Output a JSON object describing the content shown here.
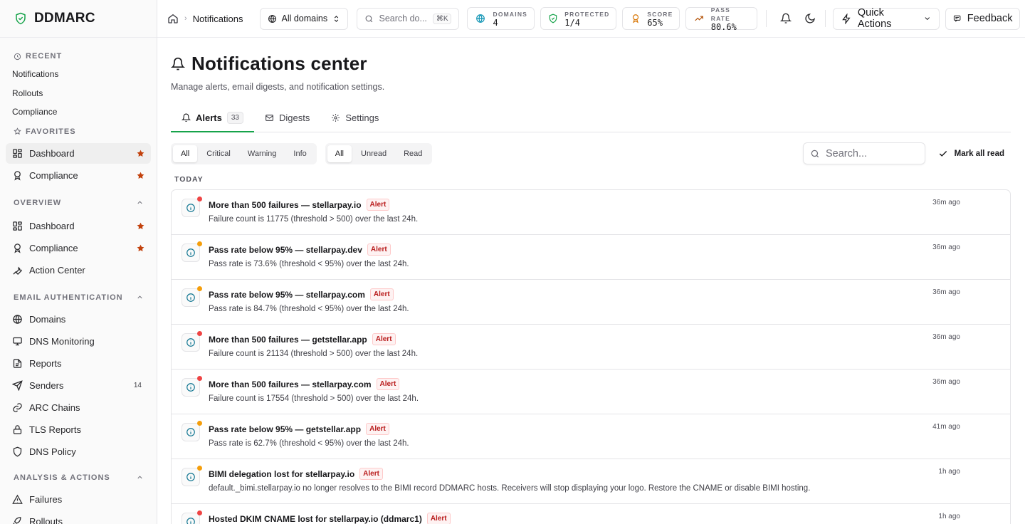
{
  "brand": {
    "name": "DDMARC"
  },
  "sidebar": {
    "recent_header": "RECENT",
    "recent": [
      "Notifications",
      "Rollouts",
      "Compliance"
    ],
    "favorites_header": "FAVORITES",
    "favorites": [
      {
        "label": "Dashboard"
      },
      {
        "label": "Compliance"
      }
    ],
    "overview_header": "OVERVIEW",
    "overview": [
      {
        "label": "Dashboard"
      },
      {
        "label": "Compliance"
      },
      {
        "label": "Action Center"
      }
    ],
    "email_auth_header": "EMAIL AUTHENTICATION",
    "email_auth": [
      {
        "label": "Domains"
      },
      {
        "label": "DNS Monitoring"
      },
      {
        "label": "Reports"
      },
      {
        "label": "Senders",
        "count": "14"
      },
      {
        "label": "ARC Chains"
      },
      {
        "label": "TLS Reports"
      },
      {
        "label": "DNS Policy"
      }
    ],
    "analysis_header": "ANALYSIS & ACTIONS",
    "analysis": [
      {
        "label": "Failures"
      },
      {
        "label": "Rollouts"
      }
    ]
  },
  "topbar": {
    "breadcrumb": "Notifications",
    "domain_select": "All domains",
    "search_placeholder": "Search do...",
    "search_kbd": "⌘K",
    "stats": [
      {
        "label": "DOMAINS",
        "value": "4",
        "icon": "globe-icon",
        "color": "#0891b2"
      },
      {
        "label": "PROTECTED",
        "value": "1/4",
        "icon": "shield-check-icon",
        "color": "#16a34a"
      },
      {
        "label": "SCORE",
        "value": "65%",
        "icon": "award-icon",
        "color": "#d97706"
      },
      {
        "label": "PASS RATE",
        "value": "80.6%",
        "icon": "trend-icon",
        "color": "#b45309"
      }
    ],
    "quick_actions": "Quick Actions",
    "feedback": "Feedback"
  },
  "page": {
    "title": "Notifications center",
    "subtitle": "Manage alerts, email digests, and notification settings.",
    "tabs": [
      {
        "label": "Alerts",
        "badge": "33"
      },
      {
        "label": "Digests"
      },
      {
        "label": "Settings"
      }
    ],
    "severity_filters": [
      "All",
      "Critical",
      "Warning",
      "Info"
    ],
    "read_filters": [
      "All",
      "Unread",
      "Read"
    ],
    "search_placeholder": "Search...",
    "mark_all_read": "Mark all read",
    "day_label": "TODAY"
  },
  "alerts": [
    {
      "title": "More than 500 failures — stellarpay.io",
      "tag": "Alert",
      "desc": "Failure count is 11775 (threshold > 500) over the last 24h.",
      "time": "36m ago",
      "dot": "red"
    },
    {
      "title": "Pass rate below 95% — stellarpay.dev",
      "tag": "Alert",
      "desc": "Pass rate is 73.6% (threshold < 95%) over the last 24h.",
      "time": "36m ago",
      "dot": "amber"
    },
    {
      "title": "Pass rate below 95% — stellarpay.com",
      "tag": "Alert",
      "desc": "Pass rate is 84.7% (threshold < 95%) over the last 24h.",
      "time": "36m ago",
      "dot": "amber"
    },
    {
      "title": "More than 500 failures — getstellar.app",
      "tag": "Alert",
      "desc": "Failure count is 21134 (threshold > 500) over the last 24h.",
      "time": "36m ago",
      "dot": "red"
    },
    {
      "title": "More than 500 failures — stellarpay.com",
      "tag": "Alert",
      "desc": "Failure count is 17554 (threshold > 500) over the last 24h.",
      "time": "36m ago",
      "dot": "red"
    },
    {
      "title": "Pass rate below 95% — getstellar.app",
      "tag": "Alert",
      "desc": "Pass rate is 62.7% (threshold < 95%) over the last 24h.",
      "time": "41m ago",
      "dot": "amber"
    },
    {
      "title": "BIMI delegation lost for stellarpay.io",
      "tag": "Alert",
      "desc": "default._bimi.stellarpay.io no longer resolves to the BIMI record DDMARC hosts. Receivers will stop displaying your logo. Restore the CNAME or disable BIMI hosting.",
      "time": "1h ago",
      "dot": "amber"
    },
    {
      "title": "Hosted DKIM CNAME lost for stellarpay.io (ddmarc1)",
      "tag": "Alert",
      "desc": "",
      "time": "1h ago",
      "dot": "red"
    }
  ]
}
